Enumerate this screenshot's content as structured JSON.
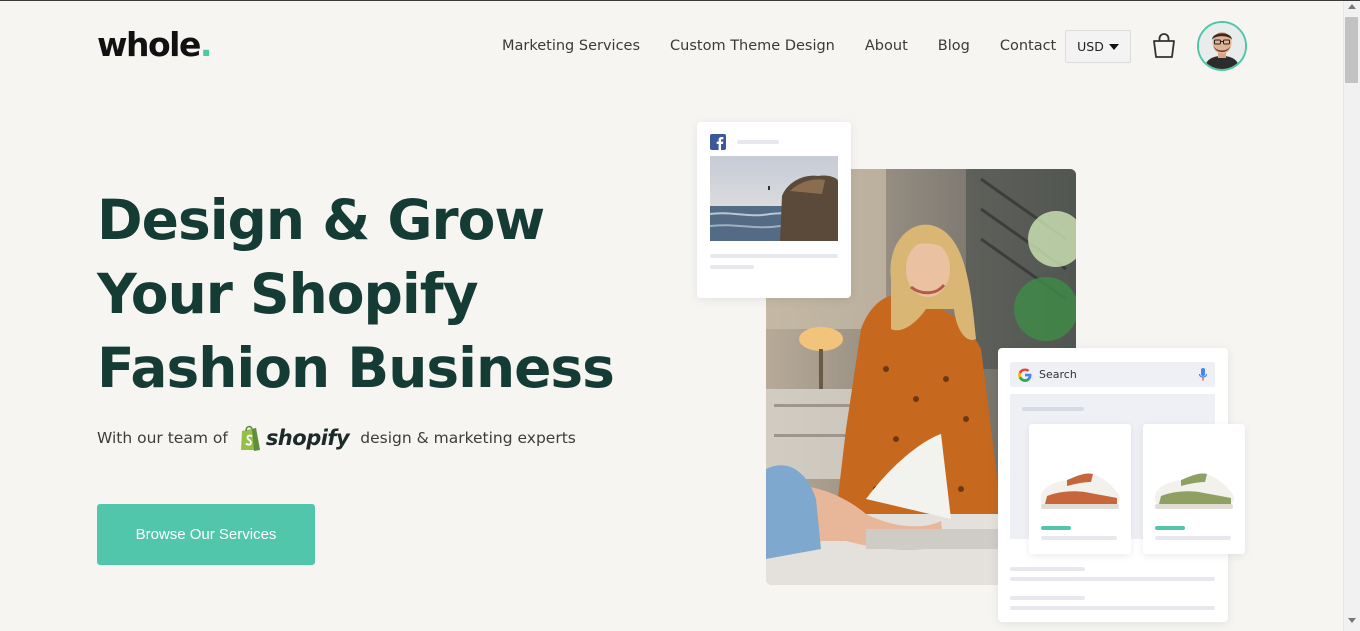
{
  "header": {
    "logo_text": "whole",
    "logo_dot": ".",
    "nav": [
      "Marketing Services",
      "Custom Theme Design",
      "About",
      "Blog",
      "Contact"
    ],
    "currency": "USD"
  },
  "hero": {
    "title_lines": [
      "Design & Grow",
      "Your Shopify",
      "Fashion Business"
    ],
    "subtitle_before": "With our team of",
    "shopify_word": "shopify",
    "subtitle_after": "design & marketing experts",
    "cta_label": "Browse Our Services"
  },
  "mockups": {
    "search_label": "Search"
  },
  "colors": {
    "accent": "#52c6ab",
    "heading": "#153b35",
    "background": "#f6f5f2"
  },
  "icons": [
    "facebook-icon",
    "google-icon",
    "microphone-icon",
    "shopping-bag-icon",
    "caret-down-icon",
    "shopify-bag-icon"
  ]
}
